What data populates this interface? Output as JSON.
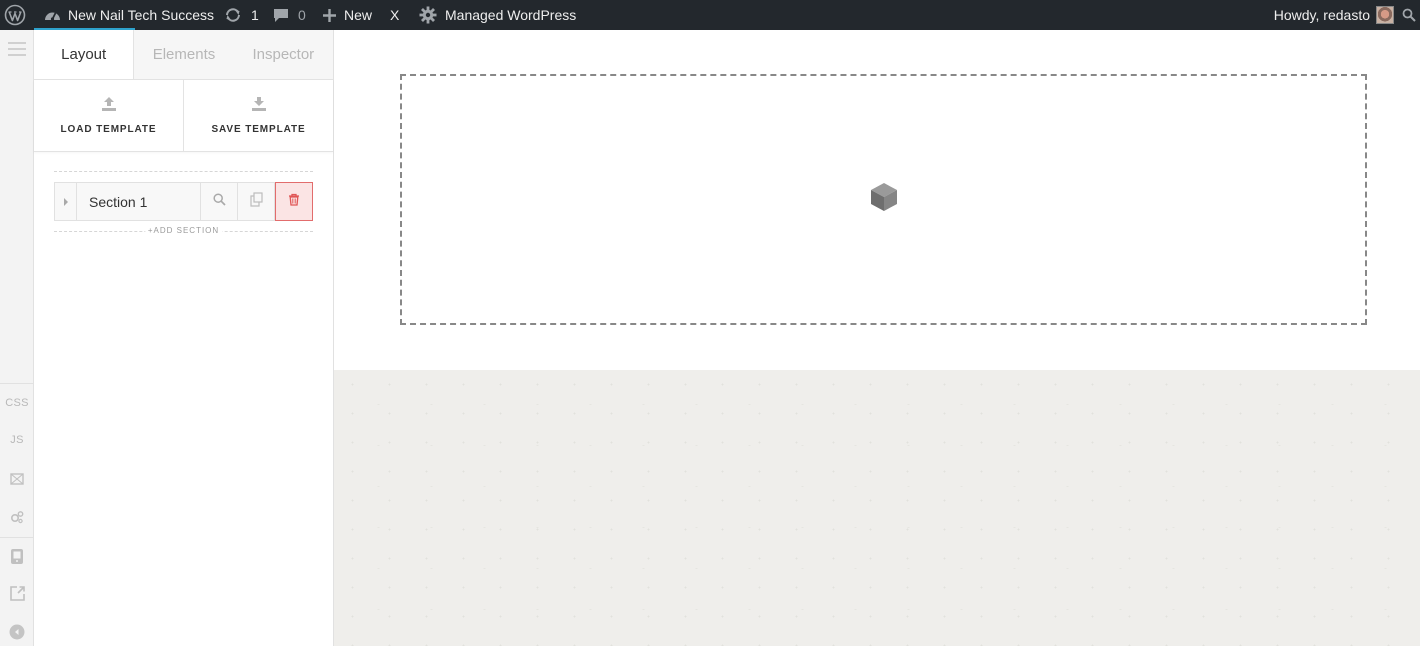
{
  "adminbar": {
    "site_name": "New Nail Tech Success",
    "updates_count": "1",
    "comments_count": "0",
    "new_label": "New",
    "x_label": "X",
    "managed_label": "Managed WordPress",
    "howdy": "Howdy, redasto"
  },
  "rail": {
    "css_label": "CSS",
    "js_label": "JS"
  },
  "panel": {
    "tabs": [
      {
        "label": "Layout",
        "active": true
      },
      {
        "label": "Elements",
        "active": false
      },
      {
        "label": "Inspector",
        "active": false
      }
    ],
    "load_template": "LOAD TEMPLATE",
    "save_template": "SAVE TEMPLATE",
    "sections": [
      {
        "name": "Section 1"
      }
    ],
    "add_section": "+ADD SECTION"
  },
  "colors": {
    "adminbar_bg": "#23282d",
    "accent": "#2ea2cc",
    "delete_border": "#e26c6c",
    "delete_bg": "#fbe4e4"
  }
}
